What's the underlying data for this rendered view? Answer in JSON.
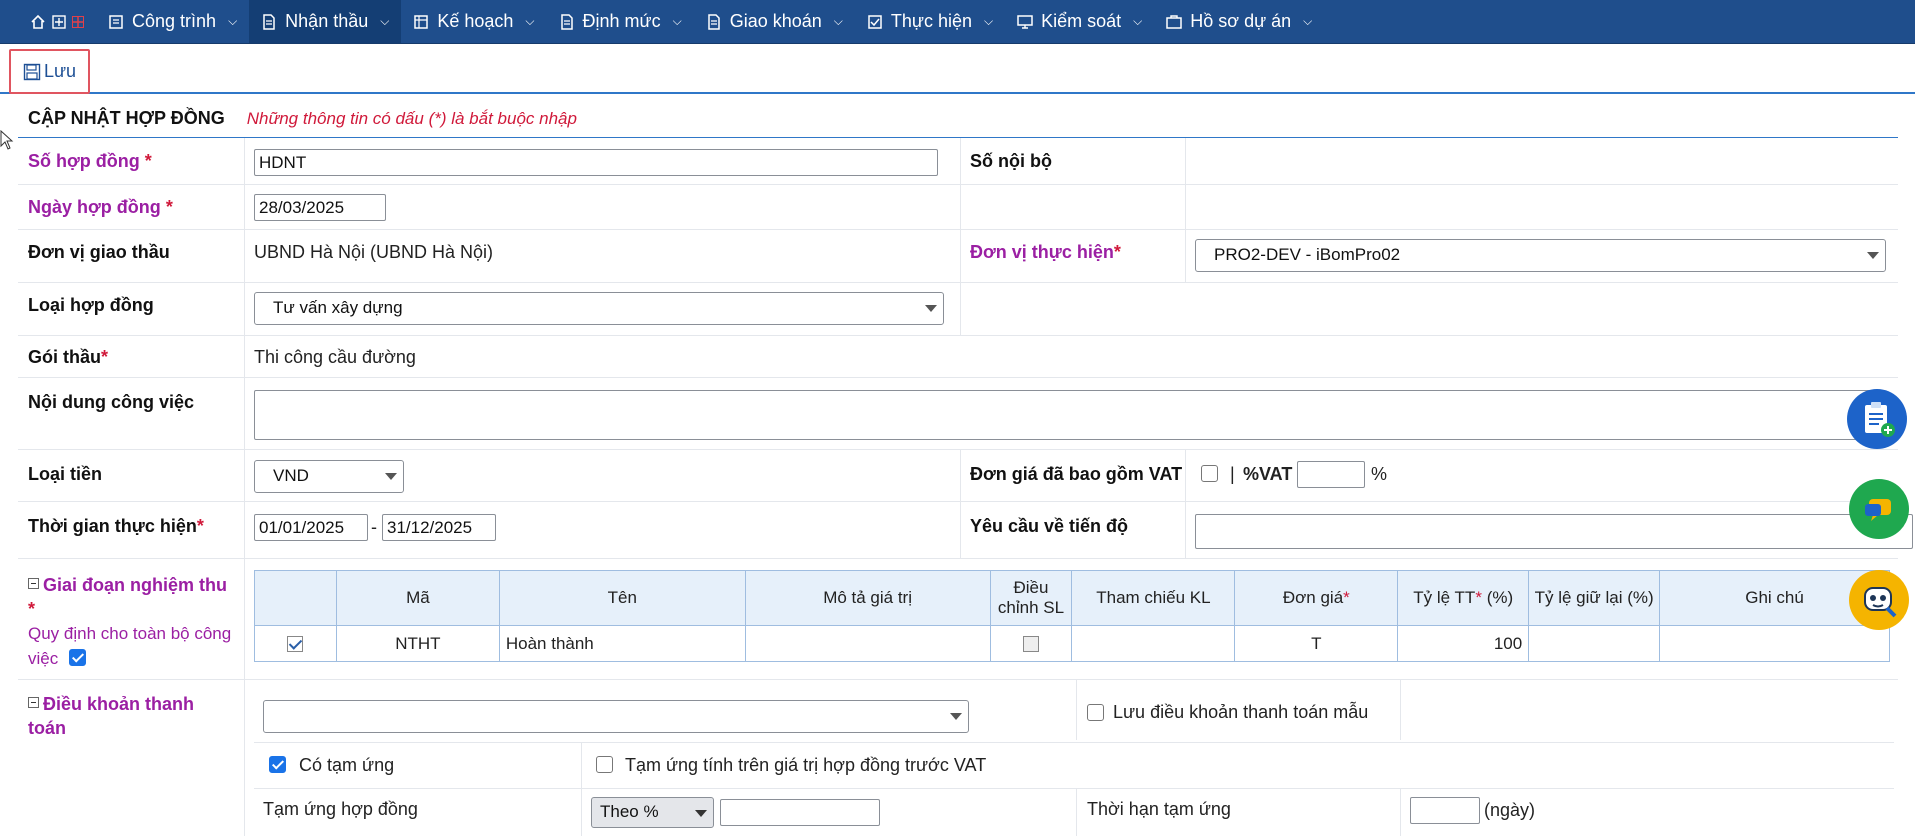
{
  "nav": {
    "items": [
      {
        "label": "Công trình",
        "active": false
      },
      {
        "label": "Nhận thầu",
        "active": true
      },
      {
        "label": "Kế hoạch",
        "active": false
      },
      {
        "label": "Định mức",
        "active": false
      },
      {
        "label": "Giao khoán",
        "active": false
      },
      {
        "label": "Thực hiện",
        "active": false
      },
      {
        "label": "Kiểm soát",
        "active": false
      },
      {
        "label": "Hồ sơ dự án",
        "active": false
      }
    ],
    "bg_color": "#1f4e8c"
  },
  "toolbar": {
    "save_label": "Lưu"
  },
  "form": {
    "title": "CẬP NHẬT HỢP ĐỒNG",
    "note": "Những thông tin có dấu (*) là bắt buộc nhập",
    "contract_no": {
      "label": "Số hợp đồng",
      "req": "*",
      "value": "HDNT"
    },
    "internal_no": {
      "label": "Số nội bộ"
    },
    "contract_date": {
      "label": "Ngày hợp đồng",
      "req": "*",
      "value": "28/03/2025"
    },
    "employer": {
      "label": "Đơn vị giao thầu",
      "value": "UBND Hà Nội (UBND Hà Nội)"
    },
    "contractor": {
      "label": "Đơn vị thực hiện",
      "req": "*",
      "value": "PRO2-DEV - iBomPro02"
    },
    "contract_type": {
      "label": "Loại hợp đồng",
      "value": "Tư vấn xây dựng"
    },
    "package": {
      "label": "Gói thầu",
      "req": "*",
      "value": "Thi công cầu đường"
    },
    "work_content": {
      "label": "Nội dung công việc",
      "value": ""
    },
    "currency": {
      "label": "Loại tiền",
      "value": "VND"
    },
    "vat_included": {
      "label": "Đơn giá đã bao gồm VAT",
      "sep": "|",
      "vat_label": "%VAT",
      "unit": "%",
      "checked": false
    },
    "period": {
      "label": "Thời gian thực hiện",
      "req": "*",
      "from": "01/01/2025",
      "dash": "-",
      "to": "31/12/2025"
    },
    "progress_req": {
      "label": "Yêu cầu về tiến độ"
    },
    "stages": {
      "label": "Giai đoạn nghiệm thu",
      "req": "*",
      "rule_label": "Quy định cho toàn bộ công việc",
      "rule_checked": true,
      "columns": [
        "",
        "Mã",
        "Tên",
        "Mô tả giá trị",
        "Điều chỉnh SL",
        "Tham chiếu KL",
        "Đơn giá",
        "Tỷ lệ TT",
        "(%)",
        "Tỷ lệ giữ lại (%)",
        "Ghi chú"
      ],
      "rows": [
        {
          "checked": true,
          "code": "NTHT",
          "name": "Hoàn thành",
          "desc": "",
          "adjust": false,
          "ref": "",
          "price": "T",
          "rate": "100",
          "retain": "",
          "note": ""
        }
      ]
    },
    "payment": {
      "label": "Điều khoản thanh toán",
      "save_template_label": "Lưu điều khoản thanh toán mẫu",
      "advance_label": "Có tạm ứng",
      "advance_checked": true,
      "advance_before_vat_label": "Tạm ứng tính trên giá trị hợp đồng trước VAT",
      "advance_contract_label": "Tạm ứng hợp đồng",
      "advance_mode": "Theo %",
      "advance_term_label": "Thời hạn tạm ứng",
      "days_unit": "(ngày)"
    }
  }
}
